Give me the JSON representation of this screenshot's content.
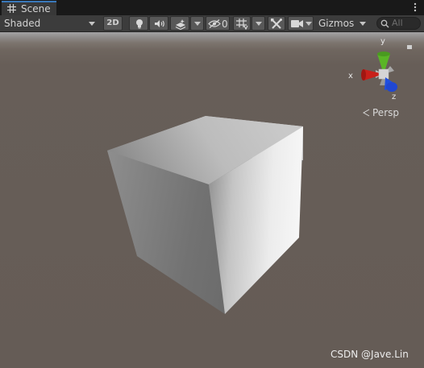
{
  "window": {
    "tab_label": "Scene"
  },
  "toolbar": {
    "draw_mode": "Shaded",
    "toggle_2d": "2D",
    "hidden_count": "0",
    "gizmos_label": "Gizmos",
    "search_placeholder": "All"
  },
  "scene_view": {
    "projection_label": "Persp",
    "axes": {
      "x": "x",
      "y": "y",
      "z": "z"
    },
    "watermark": "CSDN @Jave.Lin"
  },
  "colors": {
    "x_axis": "#c8201a",
    "y_axis": "#5ab526",
    "z_axis": "#1f4fe0",
    "tab_accent": "#3a79bb"
  },
  "icons": [
    "grid-icon",
    "kebab-menu-icon",
    "lightbulb-icon",
    "speaker-icon",
    "effects-layers-icon",
    "scene-visibility-icon",
    "grid-snap-icon",
    "tools-icon",
    "camera-icon",
    "search-icon"
  ]
}
